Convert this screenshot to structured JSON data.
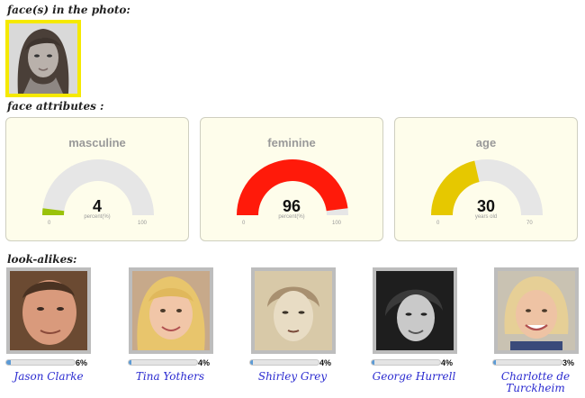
{
  "sections": {
    "faces_title": "face(s) in the photo:",
    "attributes_title": "face attributes :",
    "lookalikes_title": "look-alikes:"
  },
  "gauges": [
    {
      "title": "masculine",
      "value": "4",
      "unit": "percent(%)",
      "min": "0",
      "max": "100",
      "fraction": 0.04,
      "color": "#9ac20a"
    },
    {
      "title": "feminine",
      "value": "96",
      "unit": "percent(%)",
      "min": "0",
      "max": "100",
      "fraction": 0.96,
      "color": "#ff1a0a"
    },
    {
      "title": "age",
      "value": "30",
      "unit": "years old",
      "min": "0",
      "max": "70",
      "fraction": 0.4286,
      "color": "#e6c800"
    }
  ],
  "lookalikes": [
    {
      "name": "Jason Clarke",
      "pct": "6%",
      "fraction": 0.06
    },
    {
      "name": "Tina Yothers",
      "pct": "4%",
      "fraction": 0.04
    },
    {
      "name": "Shirley Grey",
      "pct": "4%",
      "fraction": 0.04
    },
    {
      "name": "George Hurrell",
      "pct": "4%",
      "fraction": 0.04
    },
    {
      "name": "Charlotte de Turckheim",
      "pct": "3%",
      "fraction": 0.03
    }
  ],
  "colors": {
    "face_border": "#f5e900",
    "gauge_track": "#e6e6e6",
    "name_link": "#2a2ad0",
    "bar_fill": "#5b9ad5"
  }
}
